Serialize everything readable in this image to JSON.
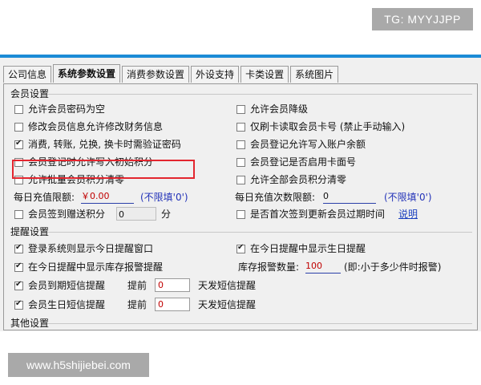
{
  "watermarks": {
    "top": "TG: MYYJJPP",
    "bottom": "www.h5shijiebei.com"
  },
  "tabs": [
    "公司信息",
    "系统参数设置",
    "消费参数设置",
    "外设支持",
    "卡类设置",
    "系统图片"
  ],
  "member_section": {
    "title": "会员设置",
    "left_items": [
      {
        "label": "允许会员密码为空",
        "checked": false
      },
      {
        "label": "修改会员信息允许修改财务信息",
        "checked": false
      },
      {
        "label": "消费, 转账, 兑换, 换卡时需验证密码",
        "checked": true
      },
      {
        "label": "会员登记时允许写入初始积分",
        "checked": false
      },
      {
        "label": "允许批量会员积分清零",
        "checked": false
      }
    ],
    "right_items": [
      {
        "label": "允许会员降级",
        "checked": false
      },
      {
        "label": "仅刷卡读取会员卡号 (禁止手动输入)",
        "checked": false
      },
      {
        "label": "会员登记允许写入账户余额",
        "checked": false
      },
      {
        "label": "会员登记是否启用卡面号",
        "checked": false
      },
      {
        "label": "允许全部会员积分清零",
        "checked": false
      }
    ],
    "daily_recharge_amount": {
      "label": "每日充值限额:",
      "value": "￥0.00",
      "hint": "(不限填'0')"
    },
    "daily_recharge_count": {
      "label": "每日充值次数限额:",
      "value": "0",
      "hint": "(不限填'0')"
    },
    "signin_points": {
      "label": "会员签到赠送积分",
      "checked": false,
      "value": "0",
      "unit": "分"
    },
    "first_signin": {
      "label": "是否首次签到更新会员过期时间",
      "checked": false,
      "link": "说明"
    }
  },
  "reminder_section": {
    "title": "提醒设置",
    "login_popup": {
      "label": "登录系统则显示今日提醒窗口",
      "checked": true
    },
    "birthday_today": {
      "label": "在今日提醒中显示生日提醒",
      "checked": true
    },
    "stock_alert": {
      "label": "在今日提醒中显示库存报警提醒",
      "checked": true
    },
    "stock_threshold": {
      "label": "库存报警数量:",
      "value": "100",
      "hint": "(即:小于多少件时报警)"
    },
    "expiry_sms": {
      "label": "会员到期短信提醒",
      "checked": true,
      "advance": "提前",
      "value": "0",
      "suffix": "天发短信提醒"
    },
    "birthday_sms": {
      "label": "会员生日短信提醒",
      "checked": true,
      "advance": "提前",
      "value": "0",
      "suffix": "天发短信提醒"
    }
  },
  "other_section": {
    "title": "其他设置"
  }
}
